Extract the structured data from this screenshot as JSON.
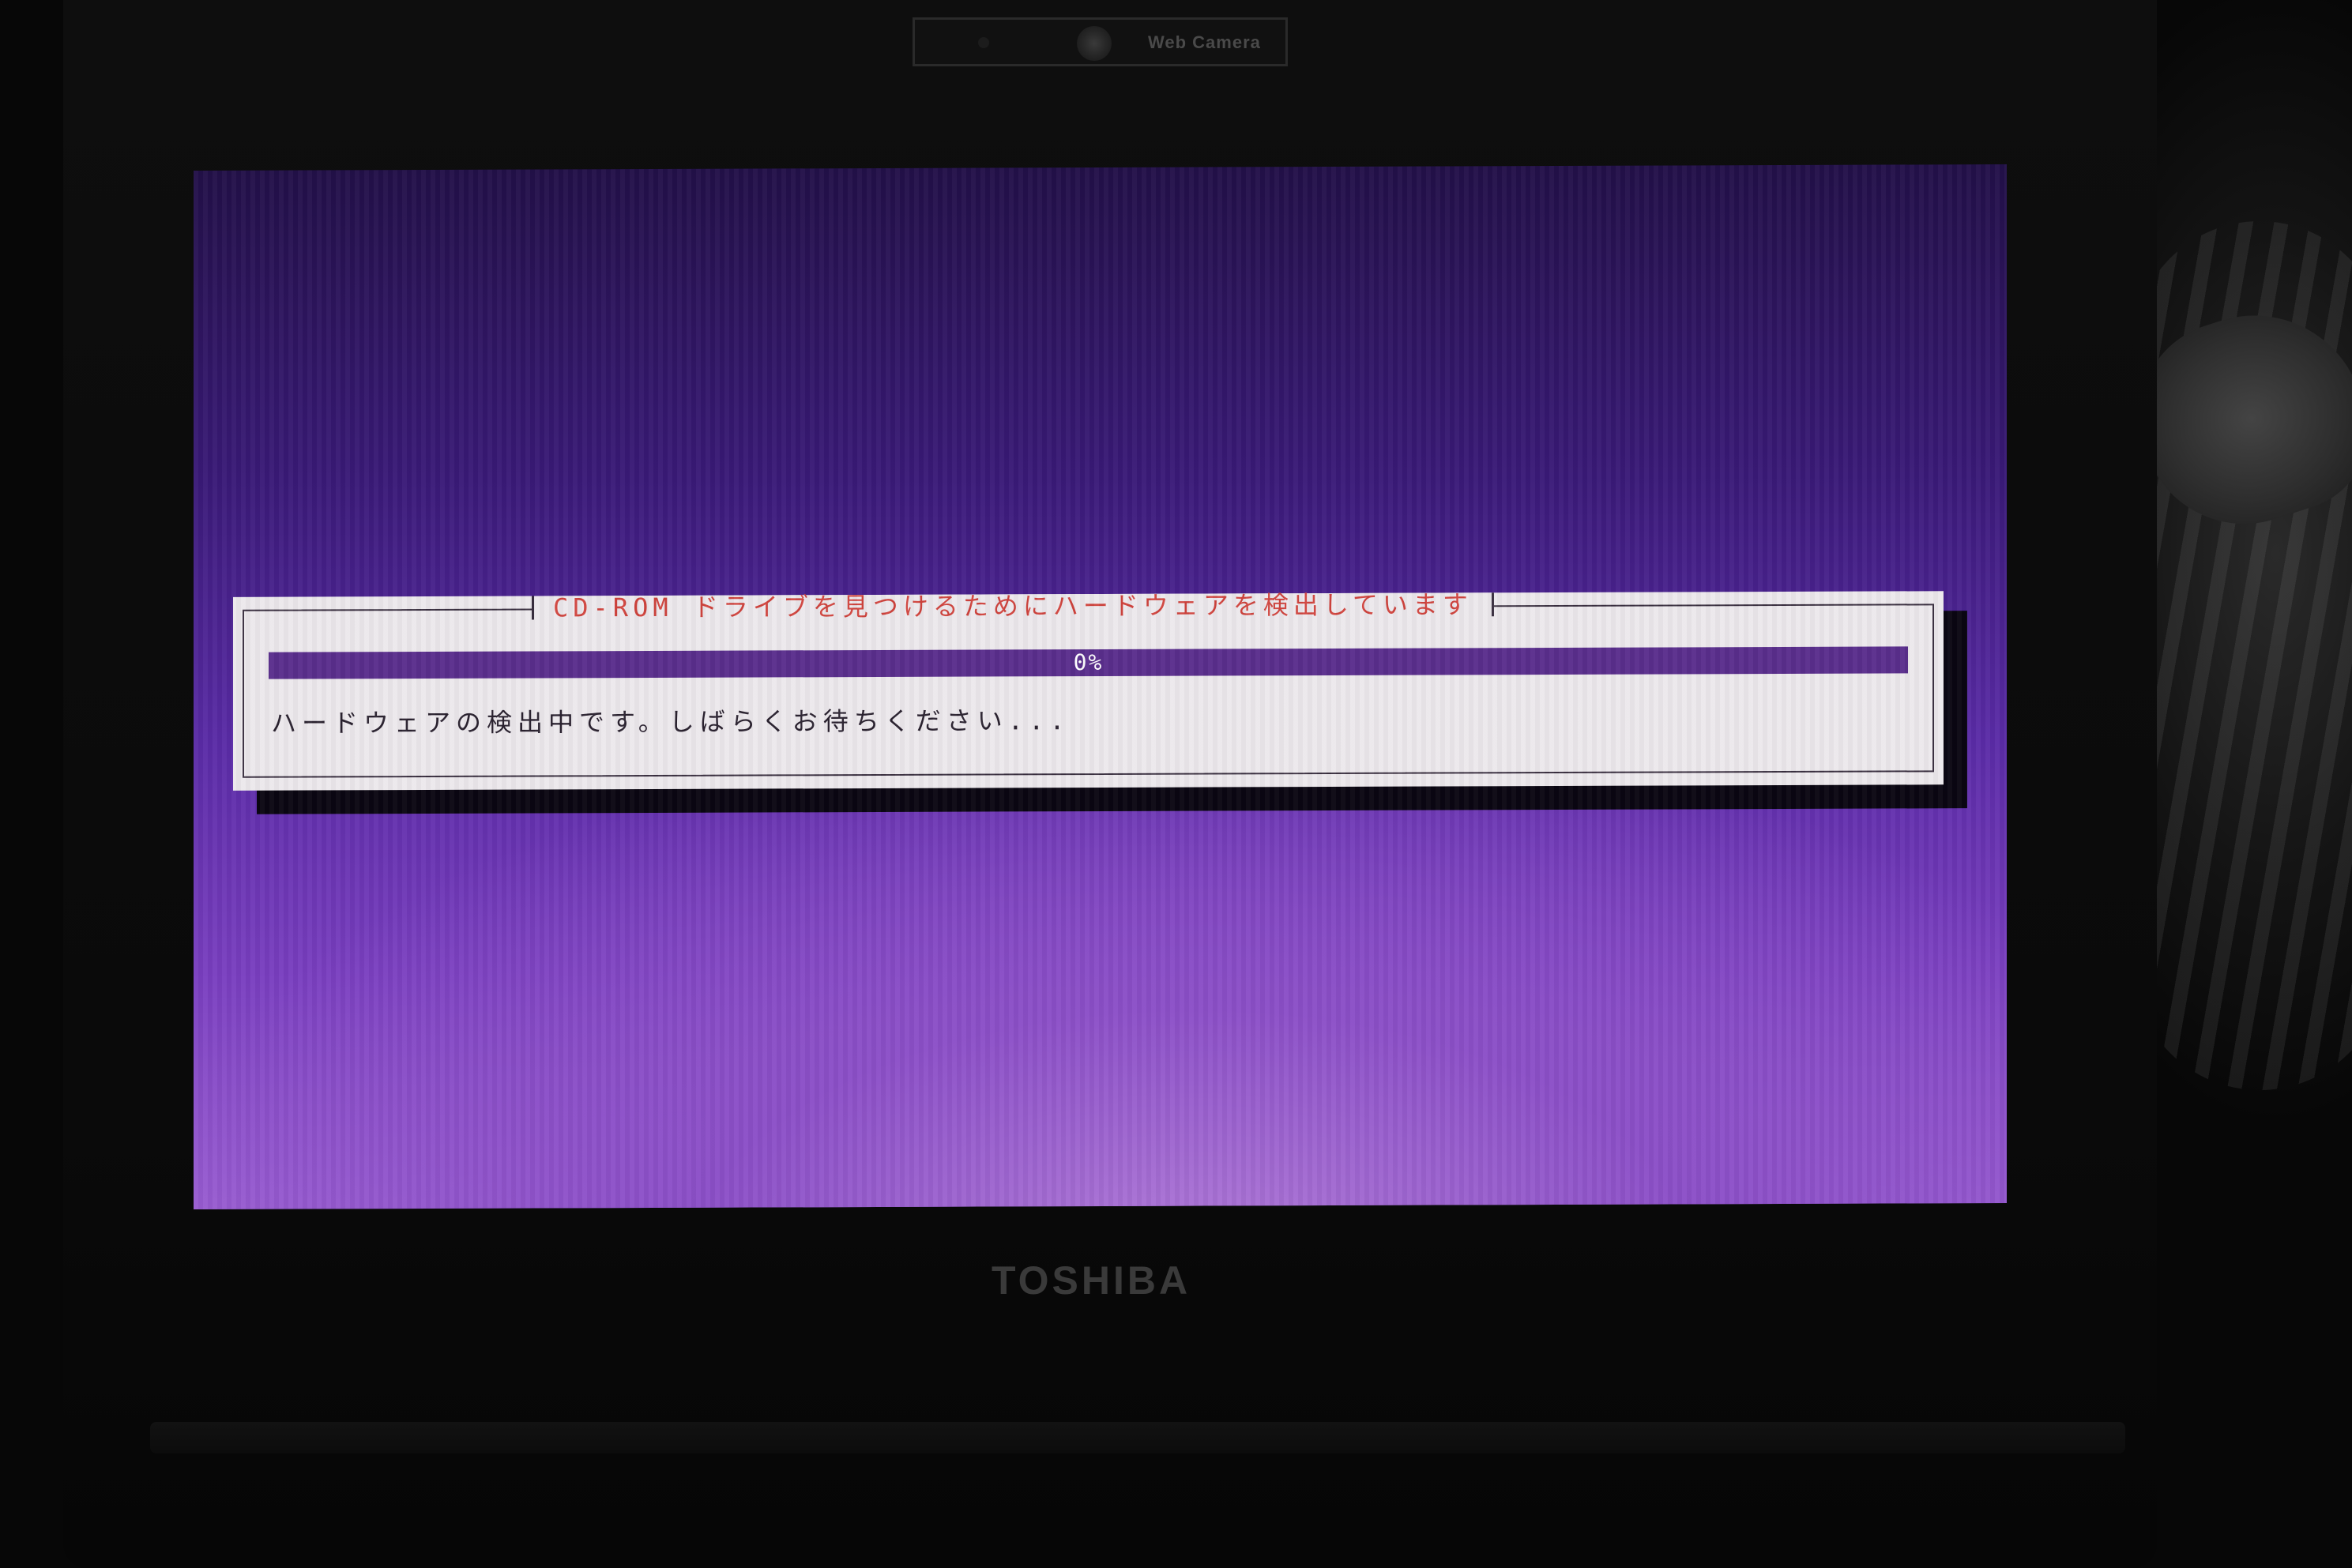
{
  "bezel": {
    "webcam_label": "Web Camera",
    "brand": "TOSHIBA"
  },
  "installer": {
    "dialog_title": "CD-ROM ドライブを見つけるためにハードウェアを検出しています",
    "progress": {
      "value_percent": 100,
      "label": "0%"
    },
    "message": "ハードウェアの検出中です。しばらくお待ちください..."
  },
  "colors": {
    "title_text": "#d0443e",
    "progress_fill": "#5a2e8c",
    "dialog_background": "#ece8ec",
    "screen_background_top": "#221048",
    "screen_background_bottom": "#9a5ed2"
  }
}
